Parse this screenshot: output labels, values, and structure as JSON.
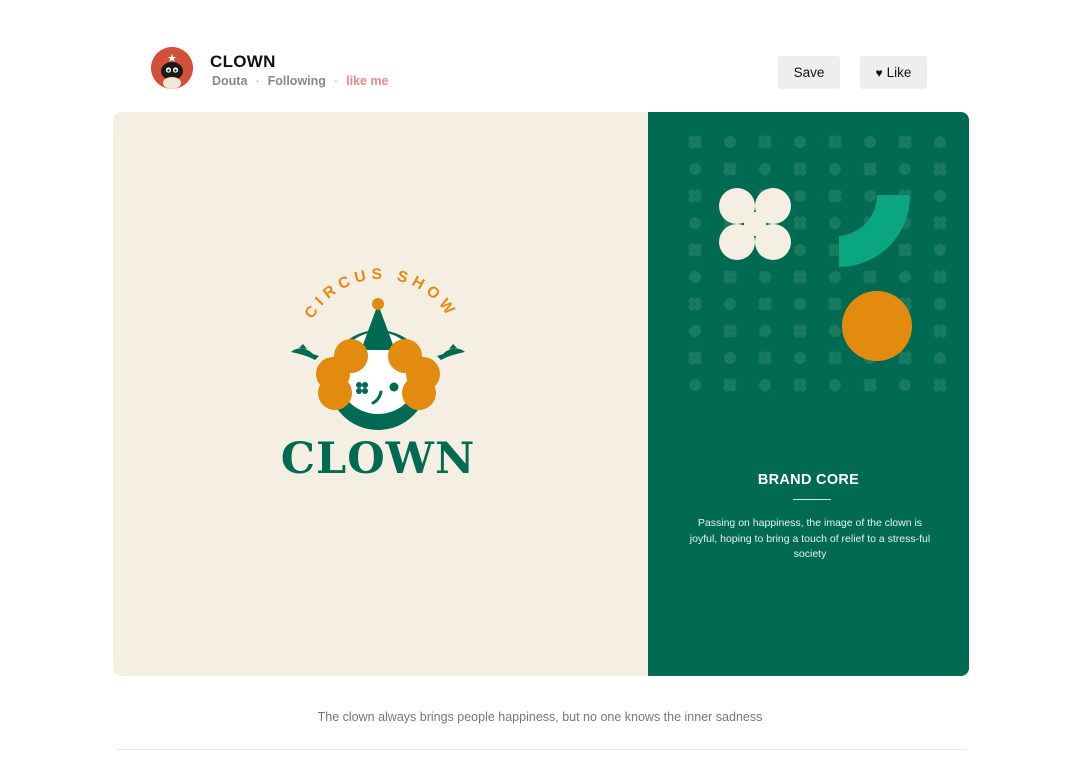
{
  "header": {
    "title": "CLOWN",
    "author": "Douta",
    "following": "Following",
    "like_me": "like me",
    "save_label": "Save",
    "like_label": "Like",
    "like_icon": "heart-icon"
  },
  "artwork": {
    "logo_arc_text": "CIRCUS SHOW",
    "logo_word": "CLOWN",
    "brand_title": "BRAND CORE",
    "brand_desc": "Passing on happiness, the image of the clown is joyful, hoping to bring a touch of relief to a stress-ful society"
  },
  "caption": "The clown always brings people happiness, but no one knows the inner sadness",
  "colors": {
    "green": "#006b52",
    "cream": "#f5efe3",
    "orange": "#e38b0e",
    "avatar_red": "#d4503a",
    "teal_accent": "#0aa581"
  }
}
